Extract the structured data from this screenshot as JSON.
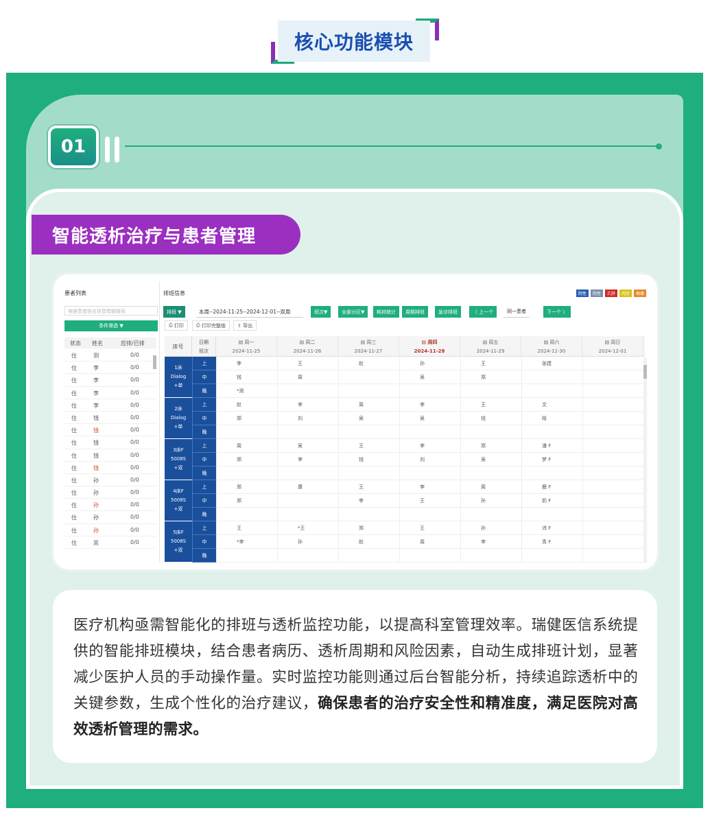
{
  "header": {
    "title": "核心功能模块"
  },
  "badge": {
    "number": "01"
  },
  "section": {
    "title": "智能透析治疗与患者管理"
  },
  "app": {
    "left_panel": {
      "title": "患者列表",
      "search_placeholder": "根据患者姓名拼音模糊搜索",
      "filter_label": "条件筛选 ▼",
      "columns": [
        "状态",
        "姓名",
        "应排/已排"
      ],
      "rows": [
        {
          "status": "住",
          "name": "测",
          "count": "0/0",
          "red": false
        },
        {
          "status": "住",
          "name": "李",
          "count": "0/0",
          "red": false
        },
        {
          "status": "住",
          "name": "李",
          "count": "0/0",
          "red": false
        },
        {
          "status": "住",
          "name": "李",
          "count": "0/0",
          "red": false
        },
        {
          "status": "住",
          "name": "李",
          "count": "0/0",
          "red": false
        },
        {
          "status": "住",
          "name": "钱",
          "count": "0/0",
          "red": false
        },
        {
          "status": "住",
          "name": "钱",
          "count": "0/0",
          "red": true
        },
        {
          "status": "住",
          "name": "钱",
          "count": "0/0",
          "red": false
        },
        {
          "status": "住",
          "name": "钱",
          "count": "0/0",
          "red": false
        },
        {
          "status": "住",
          "name": "钱",
          "count": "0/0",
          "red": true
        },
        {
          "status": "住",
          "name": "孙",
          "count": "0/0",
          "red": false
        },
        {
          "status": "住",
          "name": "孙",
          "count": "0/0",
          "red": false
        },
        {
          "status": "住",
          "name": "孙",
          "count": "0/0",
          "red": true
        },
        {
          "status": "住",
          "name": "孙",
          "count": "0/0",
          "red": false
        },
        {
          "status": "住",
          "name": "孙",
          "count": "0/0",
          "red": true
        },
        {
          "status": "住",
          "name": "吴",
          "count": "0/0",
          "red": false
        }
      ]
    },
    "right_panel": {
      "title": "排班信息",
      "legend": [
        {
          "label": "阴性",
          "color": "#2a5db0"
        },
        {
          "label": "阴性",
          "color": "#7a8fb0"
        },
        {
          "label": "乙肝",
          "color": "#d02a2a"
        },
        {
          "label": "丙肝",
          "color": "#d8c21c"
        },
        {
          "label": "梅毒",
          "color": "#e8892a"
        }
      ],
      "toolbar": {
        "schedule_btn": "排班 ▼",
        "week_select": "本周--2024-11-25--2024-12-01--双周",
        "shift_btn": "班次▼",
        "zone_btn": "全部分区▼",
        "consumables_btn": "耗材统计",
        "cycle_btn": "周期排班",
        "emergency_btn": "急诊排班",
        "prev_btn": "〈 上一个",
        "same_patient": "同一患者",
        "next_btn": "下一个 〉",
        "print_btn": "打印",
        "print_full_btn": "打印完整版",
        "export_btn": "导出"
      },
      "grid_header": {
        "bed": "床号",
        "date_label": "日期",
        "shift_label": "班次"
      },
      "days": [
        {
          "name": "周一",
          "date": "2024-11-25",
          "today": false
        },
        {
          "name": "周二",
          "date": "2024-11-26",
          "today": false
        },
        {
          "name": "周三",
          "date": "2024-11-27",
          "today": false
        },
        {
          "name": "周四",
          "date": "2024-11-28",
          "today": true
        },
        {
          "name": "周五",
          "date": "2024-11-29",
          "today": false
        },
        {
          "name": "周六",
          "date": "2024-11-30",
          "today": false
        },
        {
          "name": "周日",
          "date": "2024-12-01",
          "today": false
        }
      ],
      "beds": [
        {
          "label": "1床\nDialog\n+单",
          "shifts": [
            {
              "shift": "上",
              "cells": [
                "李",
                "王",
                "赵",
                "孙",
                "王",
                "张建",
                ""
              ]
            },
            {
              "shift": "中",
              "cells": [
                "钱",
                "周",
                "",
                "吴",
                "郑",
                "",
                ""
              ]
            },
            {
              "shift": "晚",
              "cells": [
                "*测",
                "",
                "",
                "",
                "",
                "",
                ""
              ]
            }
          ]
        },
        {
          "label": "2床\nDialog\n+单",
          "shifts": [
            {
              "shift": "上",
              "cells": [
                "赵",
                "李",
                "周",
                "李",
                "王",
                "文",
                ""
              ]
            },
            {
              "shift": "中",
              "cells": [
                "郑",
                "刘",
                "吴",
                "吴",
                "钱",
                "晗",
                ""
              ]
            },
            {
              "shift": "晚",
              "cells": [
                "",
                "",
                "",
                "",
                "",
                "",
                ""
              ]
            }
          ]
        },
        {
          "label": "3床F\n5008S\n+双",
          "shifts": [
            {
              "shift": "上",
              "cells": [
                "周",
                "吴",
                "王",
                "李",
                "郑",
                "潘 F",
                ""
              ]
            },
            {
              "shift": "中",
              "cells": [
                "郑",
                "李",
                "钱",
                "刘",
                "吴",
                "梦 F",
                ""
              ]
            },
            {
              "shift": "晚",
              "cells": [
                "",
                "",
                "",
                "",
                "",
                "",
                ""
              ]
            }
          ]
        },
        {
          "label": "4床F\n5008S\n+双",
          "shifts": [
            {
              "shift": "上",
              "cells": [
                "郑",
                "康",
                "王",
                "李",
                "周",
                "鹿 F",
                ""
              ]
            },
            {
              "shift": "中",
              "cells": [
                "郑",
                "",
                "李",
                "王",
                "孙",
                "奶 F",
                ""
              ]
            },
            {
              "shift": "晚",
              "cells": [
                "",
                "",
                "",
                "",
                "",
                "",
                ""
              ]
            }
          ]
        },
        {
          "label": "5床F\n5008S\n+双",
          "shifts": [
            {
              "shift": "上",
              "cells": [
                "王",
                "*王",
                "郑",
                "王",
                "孙",
                "沛 F",
                ""
              ]
            },
            {
              "shift": "中",
              "cells": [
                "*李",
                "孙",
                "赵",
                "周",
                "李",
                "青 F",
                ""
              ]
            },
            {
              "shift": "晚",
              "cells": [
                "",
                "",
                "",
                "",
                "",
                "",
                ""
              ]
            }
          ]
        }
      ]
    }
  },
  "description": {
    "normal": "医疗机构亟需智能化的排班与透析监控功能，以提高科室管理效率。瑞健医信系统提供的智能排班模块，结合患者病历、透析周期和风险因素，自动生成排班计划，显著减少医护人员的手动操作量。实时监控功能则通过后台智能分析，持续追踪透析中的关键参数，生成个性化的治疗建议，",
    "bold": "确保患者的治疗安全性和精准度，满足医院对高效透析管理的需求。"
  },
  "colors": {
    "green": "#1fae7e",
    "purple": "#9b2fc0",
    "navy": "#1a4f9c",
    "title_blue": "#1a4fb0"
  }
}
